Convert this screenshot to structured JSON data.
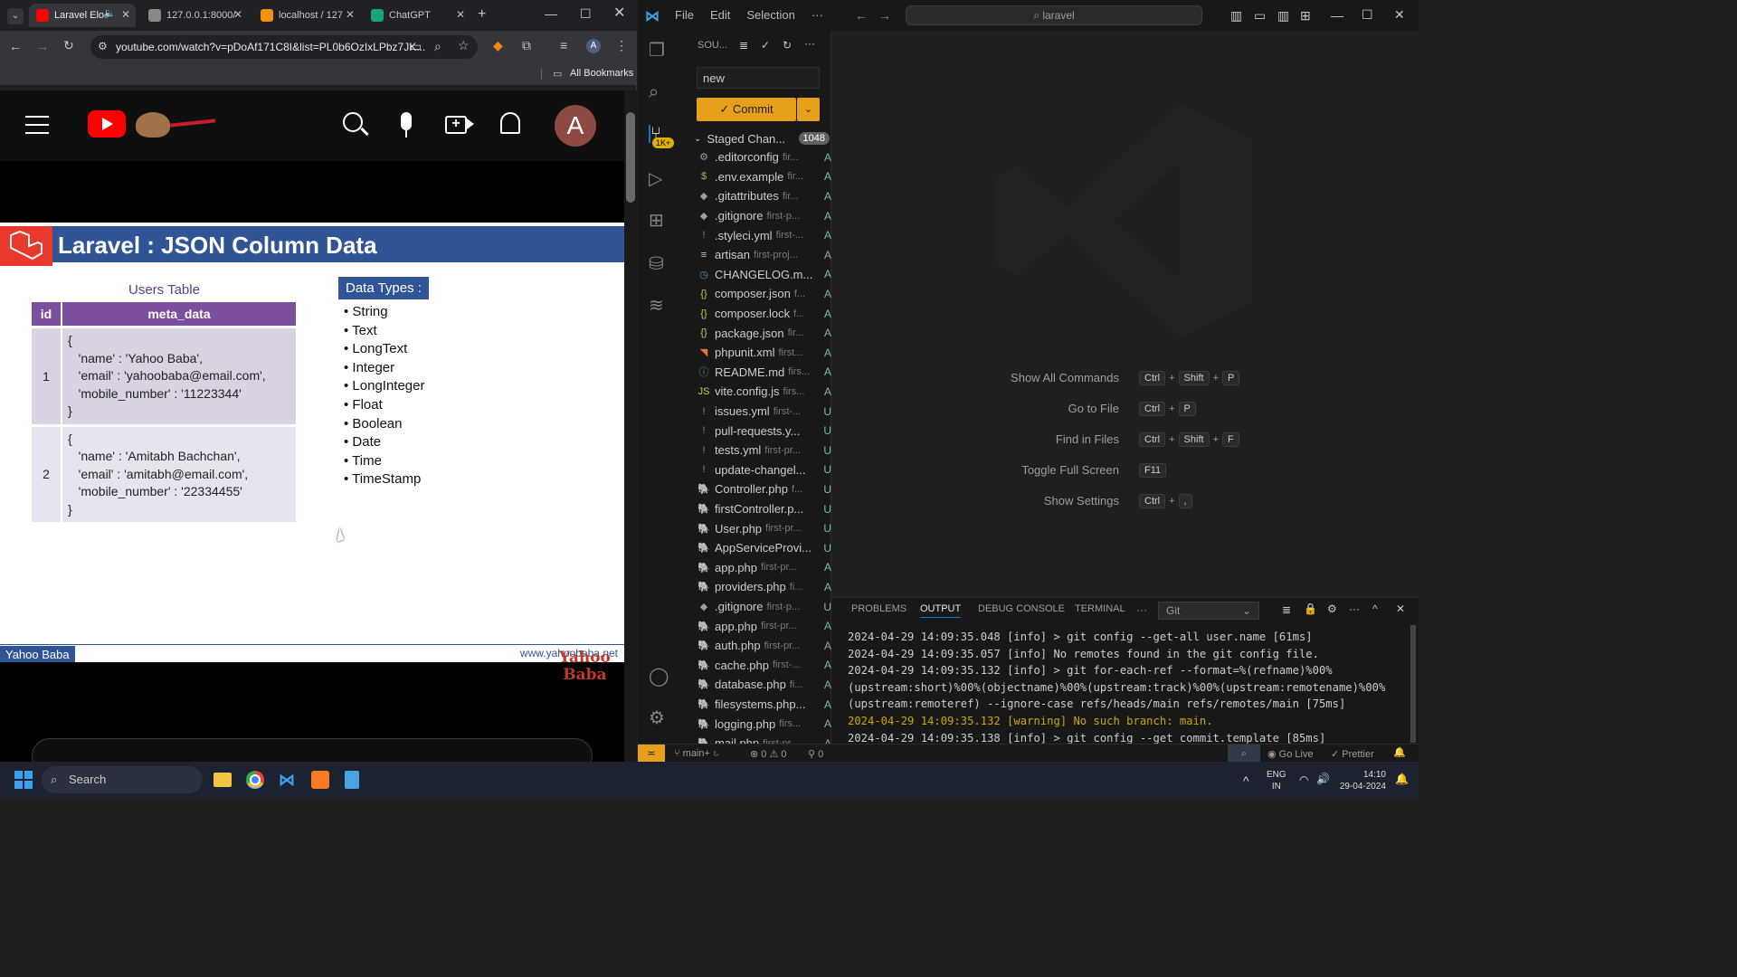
{
  "browser": {
    "tabs": [
      {
        "label": "Laravel Elo",
        "fav": "#ff0000"
      },
      {
        "label": "127.0.0.1:8000/",
        "fav": "#888"
      },
      {
        "label": "localhost / 127",
        "fav": "#f29111"
      },
      {
        "label": "ChatGPT",
        "fav": "#19a37f"
      }
    ],
    "new_tab": "+",
    "url": "youtube.com/watch?v=pDoAf171C8I&list=PL0b6OzIxLPbz7JK...",
    "all_bookmarks": "All Bookmarks"
  },
  "youtube": {
    "avatar_letter": "A"
  },
  "video": {
    "banner_title": "Laravel : JSON Column Data",
    "users_table_caption": "Users Table",
    "col_id": "id",
    "col_meta": "meta_data",
    "rows": [
      {
        "id": "1",
        "meta": "{\n   'name' : 'Yahoo Baba',\n   'email' : 'yahoobaba@email.com',\n   'mobile_number' : '11223344'\n}"
      },
      {
        "id": "2",
        "meta": "{\n   'name' : 'Amitabh Bachchan',\n   'email' : 'amitabh@email.com',\n   'mobile_number' : '22334455'\n}"
      }
    ],
    "data_types_label": "Data Types :",
    "data_types": [
      "String",
      "Text",
      "LongText",
      "Integer",
      "LongInteger",
      "Float",
      "Boolean",
      "Date",
      "Time",
      "TimeStamp"
    ],
    "footer_left": "Yahoo Baba",
    "footer_right": "www.yahoobaba.net",
    "watermark_line1": "Yahoo",
    "watermark_line2": "Baba"
  },
  "vscode": {
    "menu": [
      "File",
      "Edit",
      "Selection",
      "···"
    ],
    "search": "laravel",
    "scm_title": "SOU...",
    "commit_message": "new",
    "commit_label": "✓ Commit",
    "staged_label": "Staged Chan...",
    "staged_count": "1048",
    "badge": "1K+",
    "files": [
      {
        "name": ".editorconfig",
        "dir": "fir...",
        "st": "A",
        "icon": "⚙",
        "color": "#9d9d9d"
      },
      {
        "name": ".env.example",
        "dir": "fir...",
        "st": "A",
        "icon": "$",
        "color": "#8bc34a"
      },
      {
        "name": ".gitattributes",
        "dir": "fir...",
        "st": "A",
        "icon": "◆",
        "color": "#9d9d9d"
      },
      {
        "name": ".gitignore",
        "dir": "first-p...",
        "st": "A",
        "icon": "◆",
        "color": "#9d9d9d"
      },
      {
        "name": ".styleci.yml",
        "dir": "first-...",
        "st": "A",
        "icon": "!",
        "color": "#a074c4"
      },
      {
        "name": "artisan",
        "dir": "first-proj...",
        "st": "A",
        "icon": "≡",
        "color": "#ccc"
      },
      {
        "name": "CHANGELOG.m...",
        "dir": "",
        "st": "A",
        "icon": "◷",
        "color": "#519aba"
      },
      {
        "name": "composer.json",
        "dir": "f...",
        "st": "A",
        "icon": "{}",
        "color": "#cbcb41"
      },
      {
        "name": "composer.lock",
        "dir": "f...",
        "st": "A",
        "icon": "{}",
        "color": "#cbcb41"
      },
      {
        "name": "package.json",
        "dir": "fir...",
        "st": "A",
        "icon": "{}",
        "color": "#cbcb41"
      },
      {
        "name": "phpunit.xml",
        "dir": "first...",
        "st": "A",
        "icon": "◥",
        "color": "#e37933"
      },
      {
        "name": "README.md",
        "dir": "firs...",
        "st": "A",
        "icon": "ⓘ",
        "color": "#519aba"
      },
      {
        "name": "vite.config.js",
        "dir": "firs...",
        "st": "A",
        "icon": "JS",
        "color": "#cbcb41"
      },
      {
        "name": "issues.yml",
        "dir": "first-...",
        "st": "U",
        "icon": "!",
        "color": "#a074c4"
      },
      {
        "name": "pull-requests.y...",
        "dir": "",
        "st": "U",
        "icon": "!",
        "color": "#a074c4"
      },
      {
        "name": "tests.yml",
        "dir": "first-pr...",
        "st": "U",
        "icon": "!",
        "color": "#a074c4"
      },
      {
        "name": "update-changel...",
        "dir": "",
        "st": "U",
        "icon": "!",
        "color": "#a074c4"
      },
      {
        "name": "Controller.php",
        "dir": "f...",
        "st": "U",
        "icon": "🐘",
        "color": "#a074c4"
      },
      {
        "name": "firstController.p...",
        "dir": "",
        "st": "U",
        "icon": "🐘",
        "color": "#a074c4"
      },
      {
        "name": "User.php",
        "dir": "first-pr...",
        "st": "U",
        "icon": "🐘",
        "color": "#a074c4"
      },
      {
        "name": "AppServiceProvi...",
        "dir": "",
        "st": "U",
        "icon": "🐘",
        "color": "#a074c4"
      },
      {
        "name": "app.php",
        "dir": "first-pr...",
        "st": "A",
        "icon": "🐘",
        "color": "#a074c4"
      },
      {
        "name": "providers.php",
        "dir": "fi...",
        "st": "A",
        "icon": "🐘",
        "color": "#a074c4"
      },
      {
        "name": ".gitignore",
        "dir": "first-p...",
        "st": "U",
        "icon": "◆",
        "color": "#9d9d9d"
      },
      {
        "name": "app.php",
        "dir": "first-pr...",
        "st": "A",
        "icon": "🐘",
        "color": "#a074c4"
      },
      {
        "name": "auth.php",
        "dir": "first-pr...",
        "st": "A",
        "icon": "🐘",
        "color": "#a074c4"
      },
      {
        "name": "cache.php",
        "dir": "first-...",
        "st": "A",
        "icon": "🐘",
        "color": "#a074c4"
      },
      {
        "name": "database.php",
        "dir": "fi...",
        "st": "A",
        "icon": "🐘",
        "color": "#a074c4"
      },
      {
        "name": "filesystems.php...",
        "dir": "",
        "st": "A",
        "icon": "🐘",
        "color": "#a074c4"
      },
      {
        "name": "logging.php",
        "dir": "firs...",
        "st": "A",
        "icon": "🐘",
        "color": "#a074c4"
      },
      {
        "name": "mail.php",
        "dir": "first-pr...",
        "st": "A",
        "icon": "🐘",
        "color": "#a074c4"
      }
    ],
    "shortcuts": [
      {
        "label": "Show All Commands",
        "keys": [
          "Ctrl",
          "+",
          "Shift",
          "+",
          "P"
        ]
      },
      {
        "label": "Go to File",
        "keys": [
          "Ctrl",
          "+",
          "P"
        ]
      },
      {
        "label": "Find in Files",
        "keys": [
          "Ctrl",
          "+",
          "Shift",
          "+",
          "F"
        ]
      },
      {
        "label": "Toggle Full Screen",
        "keys": [
          "F11"
        ]
      },
      {
        "label": "Show Settings",
        "keys": [
          "Ctrl",
          "+",
          ","
        ]
      }
    ],
    "panel_tabs": [
      "PROBLEMS",
      "OUTPUT",
      "DEBUG CONSOLE",
      "TERMINAL"
    ],
    "panel_more": "···",
    "output_channel": "Git",
    "output_lines": [
      "2024-04-29 14:09:35.048 [info] > git config --get-all user.name [61ms]",
      "2024-04-29 14:09:35.057 [info] No remotes found in the git config file.",
      "2024-04-29 14:09:35.132 [info] > git for-each-ref --format=%(refname)%00%(upstream:short)%00%(objectname)%00%(upstream:track)%00%(upstream:remotename)%00%(upstream:remoteref) --ignore-case refs/heads/main refs/remotes/main [75ms]",
      "2024-04-29 14:09:35.132 [warning] No such branch: main.",
      "2024-04-29 14:09:35.138 [info] > git config --get commit.template [85ms]"
    ],
    "status": {
      "branch": "main+",
      "errors": "0",
      "warnings": "0",
      "ports": "0",
      "go_live": "Go Live",
      "prettier": "Prettier"
    }
  },
  "taskbar": {
    "search": "Search",
    "lang1": "ENG",
    "lang2": "IN",
    "time": "14:10",
    "date": "29-04-2024"
  }
}
